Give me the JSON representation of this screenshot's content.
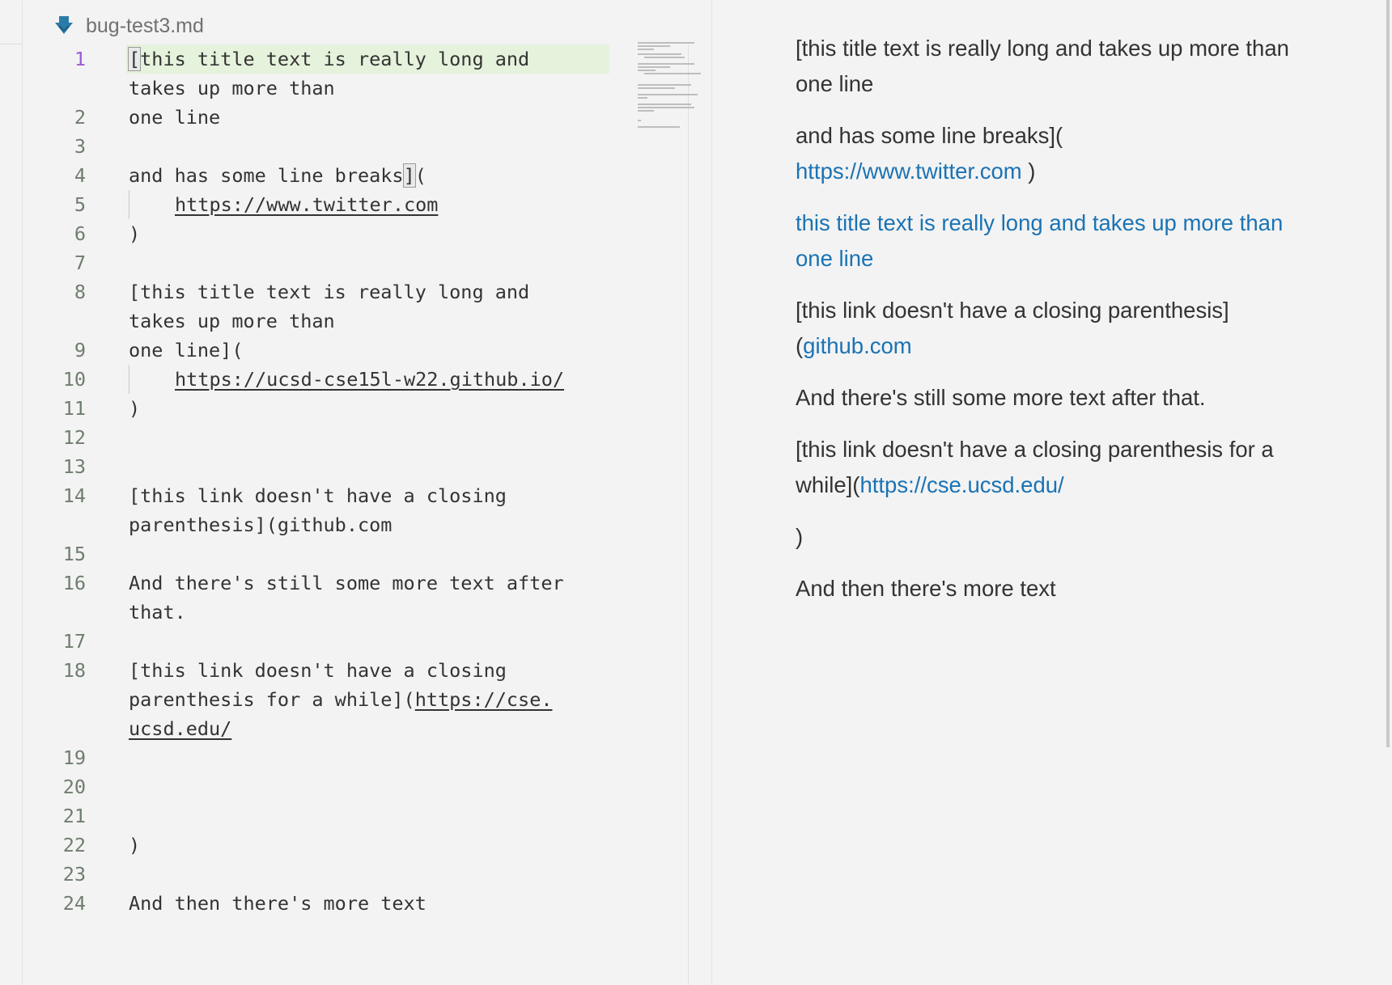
{
  "tab": {
    "filename": "bug-test3.md",
    "icon": "markdown-arrow-icon",
    "icon_color": "#2b7ba8"
  },
  "editor": {
    "lines": [
      {
        "num": "1",
        "text": "[this title text is really long and"
      },
      {
        "num": "",
        "text": "takes up more than"
      },
      {
        "num": "2",
        "text": "one line"
      },
      {
        "num": "3",
        "text": ""
      },
      {
        "num": "4",
        "text": "and has some line breaks](",
        "bracket": "]"
      },
      {
        "num": "5",
        "text": "https://www.twitter.com"
      },
      {
        "num": "6",
        "text": ")"
      },
      {
        "num": "7",
        "text": ""
      },
      {
        "num": "8",
        "text": "[this title text is really long and"
      },
      {
        "num": "",
        "text": "takes up more than"
      },
      {
        "num": "9",
        "text": "one line]("
      },
      {
        "num": "10",
        "text": "https://ucsd-cse15l-w22.github.io/"
      },
      {
        "num": "11",
        "text": ")"
      },
      {
        "num": "12",
        "text": ""
      },
      {
        "num": "13",
        "text": ""
      },
      {
        "num": "14",
        "text": "[this link doesn't have a closing"
      },
      {
        "num": "",
        "text": "parenthesis](github.com"
      },
      {
        "num": "15",
        "text": ""
      },
      {
        "num": "16",
        "text": "And there's still some more text after"
      },
      {
        "num": "",
        "text": "that."
      },
      {
        "num": "17",
        "text": ""
      },
      {
        "num": "18",
        "text": "[this link doesn't have a closing"
      },
      {
        "num": "",
        "text_prefix": "parenthesis for a while](",
        "text_link": "https://cse."
      },
      {
        "num": "",
        "text": "ucsd.edu/"
      },
      {
        "num": "19",
        "text": ""
      },
      {
        "num": "20",
        "text": ""
      },
      {
        "num": "21",
        "text": ""
      },
      {
        "num": "22",
        "text": ")"
      },
      {
        "num": "23",
        "text": ""
      },
      {
        "num": "24",
        "text": "And then there's more text"
      }
    ]
  },
  "preview": {
    "p1": "[this title text is really long and takes up more than one line",
    "p2_text": "and has some line breaks](",
    "p2_link": "https://www.twitter.com",
    "p2_suffix": " )",
    "p3_link": "this title text is really long and takes up more than one line",
    "p4_text": "[this link doesn't have a closing parenthesis] (",
    "p4_link": "github.com",
    "p5": "And there's still some more text after that.",
    "p6_text": "[this link doesn't have a closing parenthesis for a while](",
    "p6_link": "https://cse.ucsd.edu/",
    "p7": ")",
    "p8": "And then there's more text"
  },
  "colors": {
    "link": "#1a73b4",
    "active_line": "#e5f2dc",
    "line_number_current": "#9b59d8"
  }
}
